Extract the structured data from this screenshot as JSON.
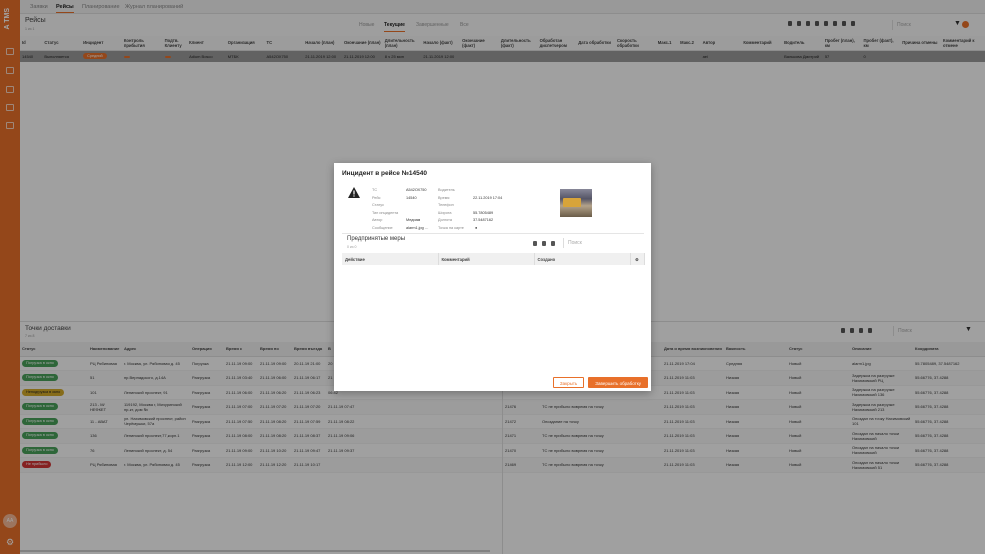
{
  "app": {
    "logo": "A TMS",
    "user_initials": "AA"
  },
  "top_tabs": [
    "Заявки",
    "Рейсы",
    "Планирование",
    "Журнал планирований"
  ],
  "header": {
    "title": "Рейсы",
    "subtitle": "1 из 1",
    "filters": [
      "Новые",
      "Текущие",
      "Завершенные",
      "Все"
    ],
    "search_placeholder": "Поиск"
  },
  "main_table": {
    "columns": [
      "Id",
      "Статус",
      "Инцидент",
      "Контроль прибытия",
      "Подтв. Клиенту",
      "Клиент",
      "Организация",
      "ТС",
      "Начало (план)",
      "Окончание (план)",
      "Длительность (план)",
      "Начало (факт)",
      "Окончание (факт)",
      "Длительность (факт)",
      "Обработан диспетчером",
      "Дата обработки",
      "Скорость обработки",
      "Макс.1",
      "Макс.2",
      "Автор",
      "Комментарий",
      "Водитель",
      "Пробег (план), км",
      "Пробег (факт), км",
      "Причина отмены",
      "Комментарий к отмене"
    ],
    "rows": [
      [
        "14540",
        "Выполняется",
        "Средний",
        "",
        "",
        "Adium Bosco",
        "МТБК",
        "А542ОХ750",
        "21.11.2019 12:00",
        "21.11.2019 12:00",
        "8 ч 25 мин",
        "21.11.2019 12:00",
        "",
        "",
        "",
        "",
        "",
        "",
        "",
        "aei",
        "",
        "Валькова Дмитрий",
        "57",
        "0",
        "",
        ""
      ]
    ]
  },
  "bottom_left": {
    "title": "Точки доставки",
    "subtitle": "7 из 8",
    "columns": [
      "Статус",
      "Наименование",
      "Адрес",
      "Операция",
      "Время с",
      "Время по",
      "Время въезда",
      "В"
    ],
    "rows": [
      [
        "Погрузка в окно",
        "РЦ Рябиновая",
        "г. Москва, ул. Рябиновая д. 45",
        "Погрузка",
        "21.11.19 09:00",
        "21.11.19 09:00",
        "20.11.19 21:00",
        "20"
      ],
      [
        "Погрузка в окно",
        "51",
        "пр.Вернадского, д.14А",
        "Разгрузка",
        "21.11.19 03:40",
        "21.11.19 06:00",
        "21.11.19 06:17",
        "21"
      ],
      [
        "Неподгрузка в окно",
        "101",
        "Ленинский проспект, 91",
        "Разгрузка",
        "21.11.19 06:00",
        "21.11.19 06:20",
        "21.11.19 06:23",
        "06:42"
      ],
      [
        "Погрузка в окно",
        "213 - М/НЕФКЕТ",
        "119192, Москва г, Мичуринский пр-кт, дом №",
        "Разгрузка",
        "21.11.19 07:00",
        "21.11.19 07:20",
        "21.11.19 07:20",
        "21.11.19 07:47"
      ],
      [
        "Погрузка в окно",
        "11 - АВАТ",
        "ул. Нахимовский проспект, район Черёмушки, 57а",
        "Разгрузка",
        "21.11.19 07:50",
        "21.11.19 08:20",
        "21.11.19 07:59",
        "21.11.19 08:22"
      ],
      [
        "Погрузка в окно",
        "136",
        "Ленинский проспект,77,корп.1",
        "Разгрузка",
        "21.11.19 08:00",
        "21.11.19 08:20",
        "21.11.19 08:37",
        "21.11.19 09:06"
      ],
      [
        "Погрузка в окно",
        "76",
        "Ленинский проспект, д. 54",
        "Разгрузка",
        "21.11.19 09:00",
        "21.11.19 10:20",
        "21.11.19 09:47",
        "21.11.19 09:37"
      ],
      [
        "Не прибыло",
        "РЦ Рябиновая",
        "г. Москва, ул. Рябиновая д. 45",
        "Разгрузка",
        "21.11.19 12:00",
        "21.11.19 12:20",
        "21.11.19 10:17",
        ""
      ]
    ]
  },
  "bottom_right": {
    "search_placeholder": "Поиск",
    "columns": [
      "Id",
      "Описание",
      "Дата и время возникновения",
      "Важность",
      "Статус",
      "Описание",
      "Координата"
    ],
    "rows": [
      [
        "",
        "",
        "21.11.2019 17:04",
        "Средняя",
        "Новый",
        "alarm1.jpg",
        "55.7805489, 37.5487162"
      ],
      [
        "",
        "",
        "21.11.2019 11:03",
        "Низкая",
        "Новый",
        "Задержка на разгрузке Нахимовский РЦ",
        "55.66776, 37.4288"
      ],
      [
        "",
        "",
        "21.11.2019 11:03",
        "Низкая",
        "Новый",
        "Задержка на разгрузке Нахимовский 136",
        "55.66776, 37.4288"
      ],
      [
        "21476",
        "ТС не прибыло вовремя на точку",
        "21.11.2019 11:03",
        "Низкая",
        "Новый",
        "Задержка на разгрузке Нахимовский 213",
        "55.66776, 37.4288"
      ],
      [
        "21472",
        "Опоздание на точку",
        "21.11.2019 11:03",
        "Низкая",
        "Новый",
        "Опоздал на точку Нахимовский 101",
        "55.66776, 37.4288"
      ],
      [
        "21471",
        "ТС не прибыло вовремя на точку",
        "21.11.2019 11:03",
        "Низкая",
        "Новый",
        "Опоздал на начало точки Нахимовский",
        "55.66776, 37.4288"
      ],
      [
        "21470",
        "ТС не прибыло вовремя на точку",
        "21.11.2019 11:03",
        "Низкая",
        "Новый",
        "Опоздал на начало точки Нахимовский",
        "55.66776, 37.4288"
      ],
      [
        "21469",
        "ТС не прибыло вовремя на точку",
        "21.11.2019 11:03",
        "Низкая",
        "Новый",
        "Опоздал на начало точки Нахимовский 51",
        "55.66776, 37.4288"
      ]
    ]
  },
  "modal": {
    "title": "Инцидент в рейсе №14540",
    "left_fields": [
      {
        "label": "ТС",
        "value": "А542ОХ750"
      },
      {
        "label": "Рейс",
        "value": "14540"
      },
      {
        "label": "Статус",
        "value": ""
      },
      {
        "label": "Тип инцидента",
        "value": ""
      },
      {
        "label": "Автор",
        "value": "Медиам"
      },
      {
        "label": "Сообщение",
        "value": "alarm1.jpg …"
      }
    ],
    "right_fields": [
      {
        "label": "Водитель",
        "value": ""
      },
      {
        "label": "Время",
        "value": "22.11.2019 17:04"
      },
      {
        "label": "Телефон",
        "value": ""
      },
      {
        "label": "Широта",
        "value": "55.7805489"
      },
      {
        "label": "Долгота",
        "value": "37.5487162"
      },
      {
        "label": "Точка на карте",
        "value": ""
      }
    ],
    "measures_title": "Предпринятые меры",
    "measures_count": "0 из 0",
    "search_placeholder": "Поиск",
    "columns": [
      "Действие",
      "Комментарий",
      "Создано"
    ],
    "close_label": "Закрыть",
    "finish_label": "Завершить обработку"
  },
  "colors": {
    "accent": "#e8702a",
    "green": "#48a05a",
    "red": "#d03636"
  }
}
